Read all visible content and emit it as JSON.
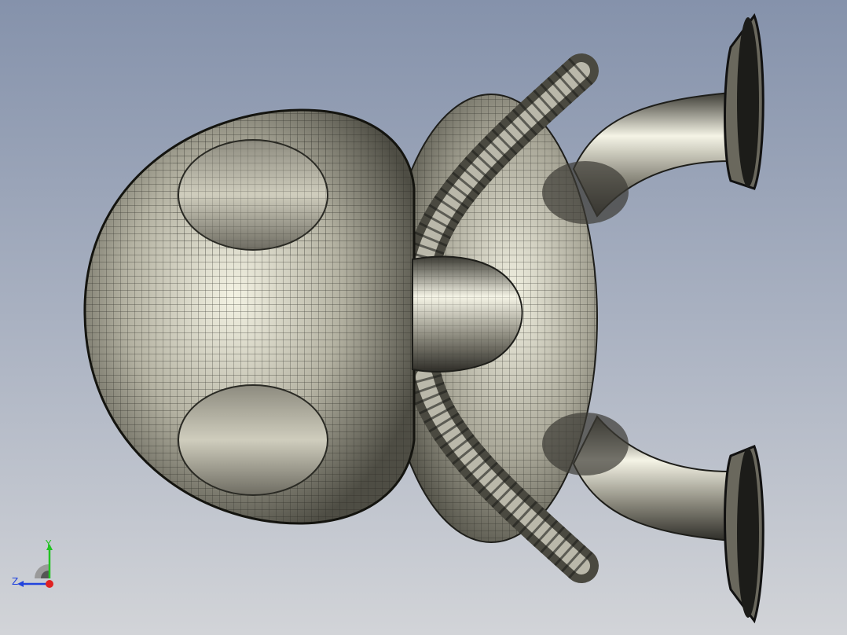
{
  "viewport": {
    "model_name": "",
    "background_top": "#8592ab",
    "background_bottom": "#d2d4d8",
    "mesh_color": "#2a2a24",
    "surface_light": "#f4f3e4",
    "surface_dark": "#4e4d44"
  },
  "triad": {
    "y_label": "Y",
    "z_label": "Z",
    "y_color": "#22c322",
    "z_color": "#2244dd",
    "x_color": "#e02222",
    "icon": "view-orientation-triad-icon"
  }
}
